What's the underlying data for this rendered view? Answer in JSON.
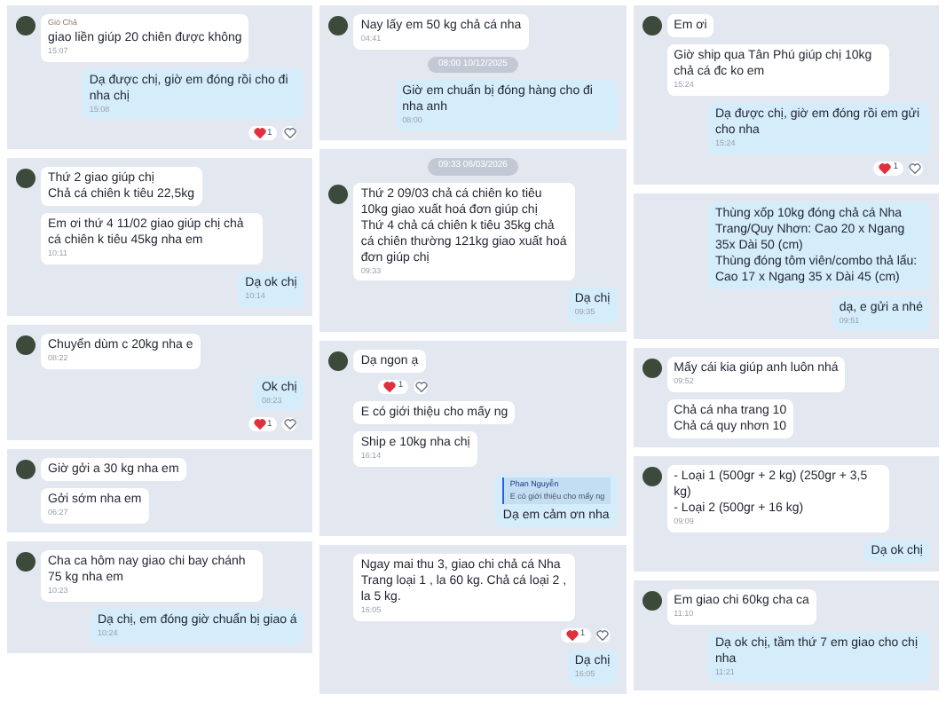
{
  "columns": [
    {
      "panels": [
        {
          "items": [
            {
              "kind": "in",
              "avatar": true,
              "sender": "Gió Chả",
              "text": "giao liền giúp  20 chiên được không",
              "time": "15:07"
            },
            {
              "kind": "out",
              "text": "Dạ được chị, giờ em đóng rồi cho đi nha chị",
              "time": "15:08"
            },
            {
              "kind": "reactions",
              "count": "1"
            }
          ]
        },
        {
          "items": [
            {
              "kind": "in",
              "avatar": true,
              "text": "Thứ 2 giao giúp chị\nChả cá chiên k tiêu 22,5kg"
            },
            {
              "kind": "in",
              "avatar": false,
              "text": "Em ơi thứ 4 11/02 giao giúp chị chả cá chiên k tiêu 45kg nha em",
              "time": "10:11"
            },
            {
              "kind": "out",
              "text": "Dạ ok chị",
              "time": "10:14"
            }
          ]
        },
        {
          "items": [
            {
              "kind": "in",
              "avatar": true,
              "text": "Chuyển dùm c 20kg nha e",
              "time": "08:22"
            },
            {
              "kind": "out",
              "text": "Ok chị",
              "time": "08:23"
            },
            {
              "kind": "reactions",
              "count": "1"
            }
          ]
        },
        {
          "items": [
            {
              "kind": "in",
              "avatar": true,
              "text": "Giờ gởi a  30 kg nha em"
            },
            {
              "kind": "in",
              "avatar": false,
              "text": "Gởi sớm nha em",
              "time": "06:27"
            }
          ]
        },
        {
          "items": [
            {
              "kind": "in",
              "avatar": true,
              "text": "Cha ca hôm nay giao chi bay chánh 75 kg nha em",
              "time": "10:23"
            },
            {
              "kind": "out",
              "text": "Dạ chị, em đóng giờ chuẩn bị giao á",
              "time": "10:24"
            }
          ]
        }
      ]
    },
    {
      "panels": [
        {
          "items": [
            {
              "kind": "in",
              "avatar": true,
              "text": "Nay lấy em 50 kg chả cá nha",
              "time": "04:41"
            },
            {
              "kind": "date",
              "text": "08:00 10/12/2025"
            },
            {
              "kind": "out",
              "text": "Giờ em chuẩn bị đóng hàng cho đi nha anh",
              "time": "08:00"
            }
          ]
        },
        {
          "items": [
            {
              "kind": "date",
              "text": "09:33 06/03/2026"
            },
            {
              "kind": "in",
              "avatar": true,
              "text": "Thứ 2 09/03 chả cá chiên ko tiêu 10kg giao xuất hoá đơn giúp chị\nThứ 4 chả cá chiên k tiêu 35kg  chả cá chiên thường 121kg giao xuất hoá đơn giúp chị",
              "time": "09:33"
            },
            {
              "kind": "out",
              "text": "Dạ chị",
              "time": "09:35"
            }
          ]
        },
        {
          "items": [
            {
              "kind": "in",
              "avatar": true,
              "text": "Dạ ngon ạ"
            },
            {
              "kind": "reactions_left",
              "count": "1"
            },
            {
              "kind": "in",
              "avatar": false,
              "text": "E có giới thiệu cho mấy ng"
            },
            {
              "kind": "in",
              "avatar": false,
              "text": "Ship e 10kg nha chị",
              "time": "16:14"
            },
            {
              "kind": "out",
              "quote": {
                "name": "Phan Nguyễn",
                "text": "E có giới thiệu cho mấy ng"
              },
              "text": "Dạ em cảm ơn nha"
            }
          ]
        },
        {
          "items": [
            {
              "kind": "in",
              "avatar": false,
              "text": "Ngay mai thu 3, giao chi chả cá Nha Trang loại 1 , la 60 kg. Chả cá loại 2 , la 5 kg.",
              "time": "16:05"
            },
            {
              "kind": "reactions",
              "count": "1"
            },
            {
              "kind": "out",
              "text": "Dạ chị",
              "time": "16:05"
            }
          ]
        }
      ]
    },
    {
      "panels": [
        {
          "items": [
            {
              "kind": "in",
              "avatar": true,
              "text": "Em ơi"
            },
            {
              "kind": "in",
              "avatar": false,
              "text": "Giờ ship qua Tân Phú giúp chị 10kg chả cá đc ko em",
              "time": "15:24"
            },
            {
              "kind": "out",
              "text": "Dạ được chị, giờ em đóng rồi em gửi cho nha",
              "time": "15:24"
            },
            {
              "kind": "reactions",
              "count": "1"
            }
          ]
        },
        {
          "items": [
            {
              "kind": "out",
              "text": "Thùng xốp 10kg đóng chả cá Nha Trang/Quy Nhơn: Cao 20 x Ngang 35x Dài 50 (cm)\nThùng đóng tôm viên/combo thả lẩu: Cao 17 x Ngang 35 x Dài 45 (cm)"
            },
            {
              "kind": "out",
              "text": "dạ, e gửi a nhé",
              "time": "09:51"
            }
          ]
        },
        {
          "items": [
            {
              "kind": "in",
              "avatar": true,
              "text": "Mấy cái kia giúp anh luôn nhá",
              "time": "09:52"
            },
            {
              "kind": "in",
              "avatar": false,
              "text": "Chả cá nha trang 10\nChả cá quy nhơn 10"
            }
          ]
        },
        {
          "items": [
            {
              "kind": "in",
              "avatar": true,
              "text": "- Loại 1 (500gr + 2 kg) (250gr + 3,5 kg)\n- Loại 2 (500gr + 16 kg)",
              "time": "09:09"
            },
            {
              "kind": "out",
              "text": "Dạ ok chị"
            }
          ]
        },
        {
          "items": [
            {
              "kind": "in",
              "avatar": true,
              "text": "Em giao chi 60kg cha ca",
              "time": "11:10"
            },
            {
              "kind": "out",
              "text": "Dạ ok chị, tầm thứ 7 em giao cho chị nha",
              "time": "11:21"
            }
          ]
        }
      ]
    }
  ]
}
